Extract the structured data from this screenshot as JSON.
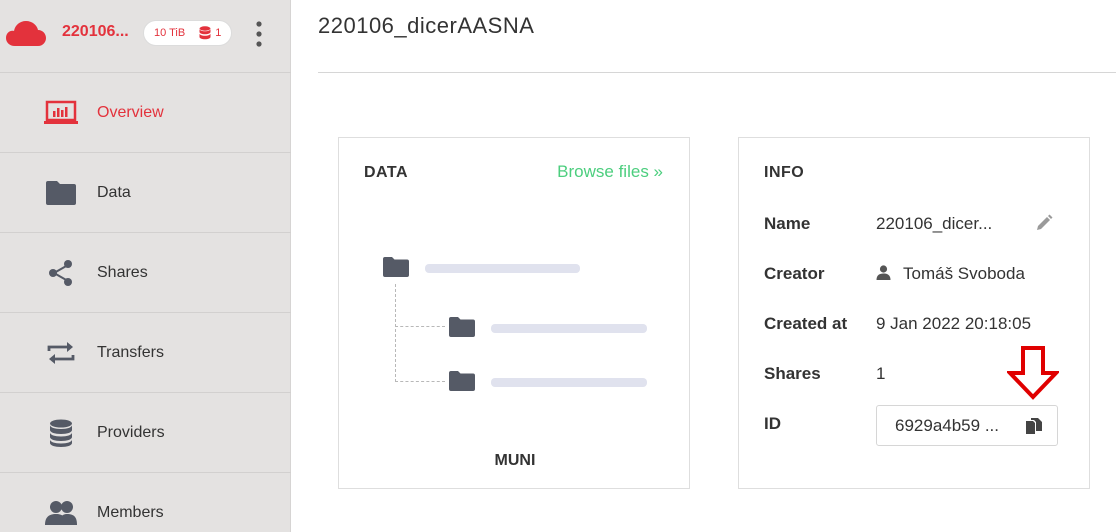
{
  "sidebar": {
    "space_name": "220106...",
    "quota": "10 TiB",
    "providers_count": "1",
    "items": [
      {
        "label": "Overview",
        "icon": "overview-icon",
        "active": true
      },
      {
        "label": "Data",
        "icon": "folder-icon"
      },
      {
        "label": "Shares",
        "icon": "share-icon"
      },
      {
        "label": "Transfers",
        "icon": "transfer-icon"
      },
      {
        "label": "Providers",
        "icon": "database-icon"
      },
      {
        "label": "Members",
        "icon": "members-icon"
      }
    ]
  },
  "main": {
    "title": "220106_dicerAASNA",
    "data_card": {
      "heading": "DATA",
      "browse_link": "Browse files »",
      "provider": "MUNI"
    },
    "info_card": {
      "heading": "INFO",
      "rows": {
        "name_label": "Name",
        "name_value": "220106_dicer...",
        "creator_label": "Creator",
        "creator_value": "Tomáš Svoboda",
        "created_label": "Created at",
        "created_value": "9 Jan 2022 20:18:05",
        "shares_label": "Shares",
        "shares_value": "1",
        "id_label": "ID",
        "id_value": "6929a4b59 ..."
      }
    }
  },
  "colors": {
    "accent": "#e3323c",
    "link": "#4cce7e",
    "sidebar_bg": "#e4e2e1",
    "icon_dark": "#555a66",
    "annotation_arrow": "#e00000"
  }
}
